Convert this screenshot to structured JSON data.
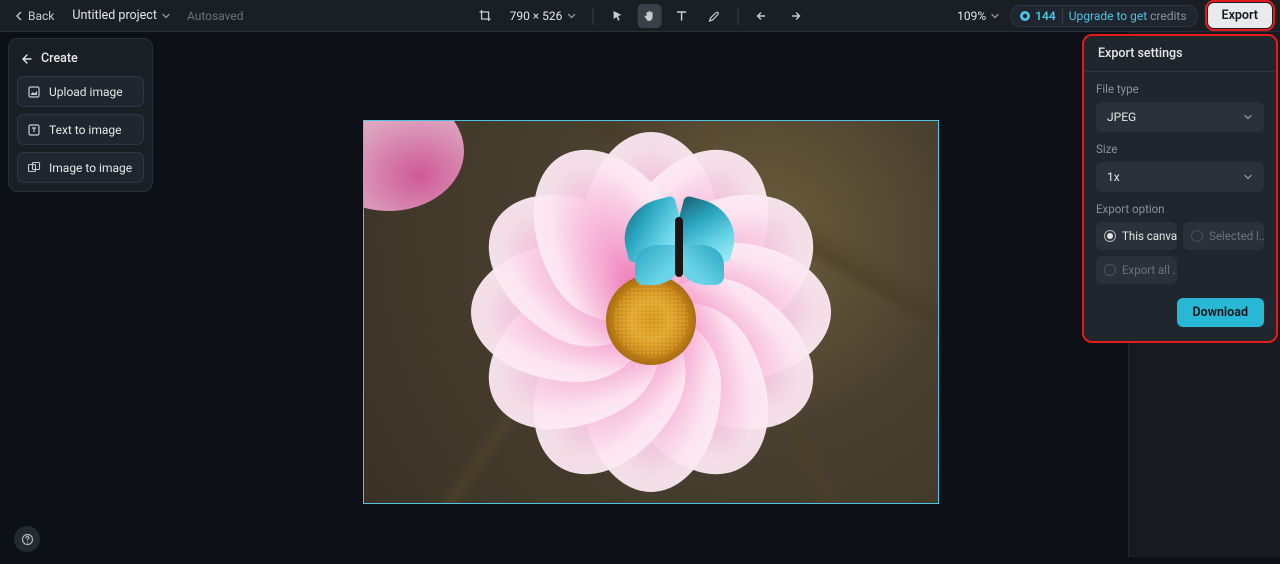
{
  "topbar": {
    "back": "Back",
    "project_name": "Untitled project",
    "autosaved": "Autosaved",
    "dimensions": "790 × 526",
    "zoom": "109%",
    "credits": "144",
    "upgrade_prefix": "Upgrade to get ",
    "upgrade_suffix": "credits",
    "export": "Export"
  },
  "sidebar": {
    "create": "Create",
    "items": [
      {
        "label": "Upload image"
      },
      {
        "label": "Text to image"
      },
      {
        "label": "Image to image"
      }
    ]
  },
  "export_panel": {
    "title": "Export settings",
    "file_type_label": "File type",
    "file_type_value": "JPEG",
    "size_label": "Size",
    "size_value": "1x",
    "option_label": "Export option",
    "opt_this_canvas": "This canvas",
    "opt_selected": "Selected l...",
    "opt_export_all": "Export all ...",
    "download": "Download"
  }
}
